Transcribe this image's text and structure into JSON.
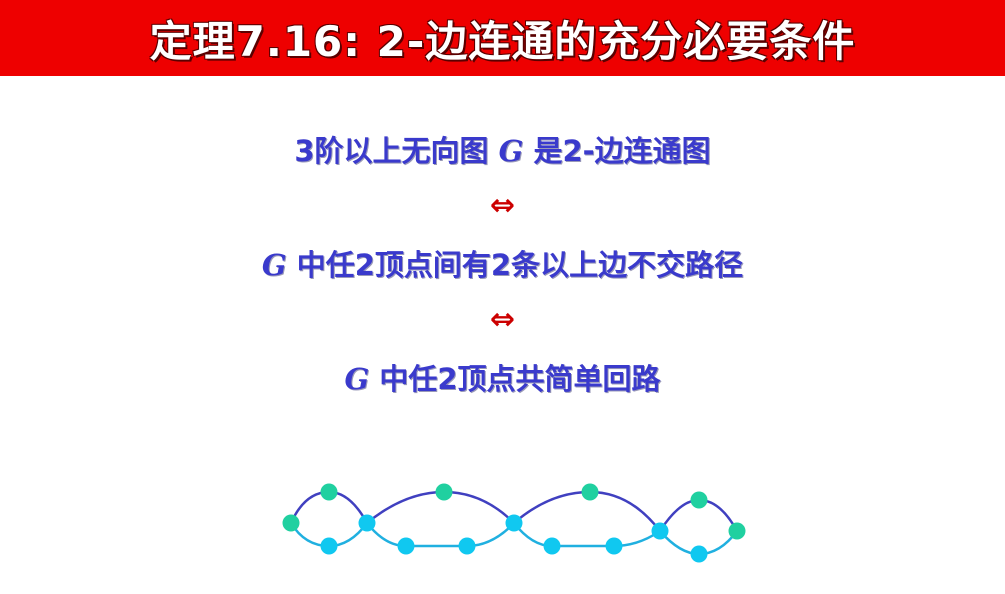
{
  "title": "定理7.16: 2-边连通的充分必要条件",
  "lines": [
    {
      "pre": "3阶以上无向图 ",
      "g": "G",
      "post": " 是2-边连通图"
    },
    {
      "pre": "",
      "g": "G",
      "post": " 中任2顶点间有2条以上边不交路径"
    },
    {
      "pre": "",
      "g": "G",
      "post": " 中任2顶点共简单回路"
    }
  ],
  "arrow": "⇔",
  "colors": {
    "title_bg": "#ee0000",
    "text": "#3a3acc",
    "arrow": "#cc0000",
    "upper_edge": "#4040c0",
    "lower_edge": "#20b0e0",
    "node_green": "#20d0a0",
    "node_cyan": "#10c8f0"
  }
}
